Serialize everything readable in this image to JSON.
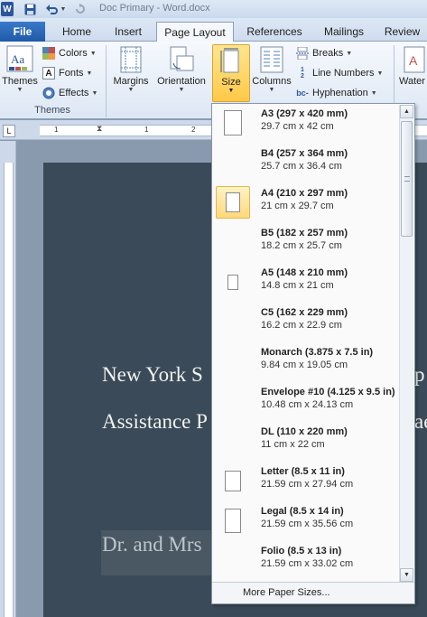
{
  "titlebar": {
    "title": "Doc Primary - Word.docx"
  },
  "tabs": {
    "file": "File",
    "home": "Home",
    "insert": "Insert",
    "page_layout": "Page Layout",
    "references": "References",
    "mailings": "Mailings",
    "review": "Review"
  },
  "ribbon": {
    "themes": "Themes",
    "colors": "Colors",
    "fonts": "Fonts",
    "effects": "Effects",
    "themes_group": "Themes",
    "margins": "Margins",
    "orientation": "Orientation",
    "size": "Size",
    "columns": "Columns",
    "breaks": "Breaks",
    "line_numbers": "Line Numbers",
    "hyphenation": "Hyphenation",
    "watermark": "Water"
  },
  "ruler": {
    "numbers": [
      "1",
      "1",
      "2"
    ]
  },
  "document": {
    "line1": "New York S",
    "line1_right": "p",
    "line2": "Assistance P",
    "line2_right": "ae",
    "line3": "Dr. and Mrs"
  },
  "size_menu": {
    "items": [
      {
        "name": "A3 (297 x 420 mm)",
        "dims": "29.7 cm x 42 cm"
      },
      {
        "name": "B4 (257 x 364 mm)",
        "dims": "25.7 cm x 36.4 cm"
      },
      {
        "name": "A4 (210 x 297 mm)",
        "dims": "21 cm x 29.7 cm"
      },
      {
        "name": "B5 (182 x 257 mm)",
        "dims": "18.2 cm x 25.7 cm"
      },
      {
        "name": "A5 (148 x 210 mm)",
        "dims": "14.8 cm x 21 cm"
      },
      {
        "name": "C5 (162 x 229 mm)",
        "dims": "16.2 cm x 22.9 cm"
      },
      {
        "name": "Monarch (3.875 x 7.5 in)",
        "dims": "9.84 cm x 19.05 cm"
      },
      {
        "name": "Envelope #10 (4.125 x 9.5 in)",
        "dims": "10.48 cm x 24.13 cm"
      },
      {
        "name": "DL (110 x 220 mm)",
        "dims": "11 cm x 22 cm"
      },
      {
        "name": "Letter (8.5 x 11 in)",
        "dims": "21.59 cm x 27.94 cm"
      },
      {
        "name": "Legal (8.5 x 14 in)",
        "dims": "21.59 cm x 35.56 cm"
      },
      {
        "name": "Folio (8.5 x 13 in)",
        "dims": "21.59 cm x 33.02 cm"
      }
    ],
    "selected": "A4 (210 x 297 mm)",
    "more": "More Paper Sizes..."
  }
}
